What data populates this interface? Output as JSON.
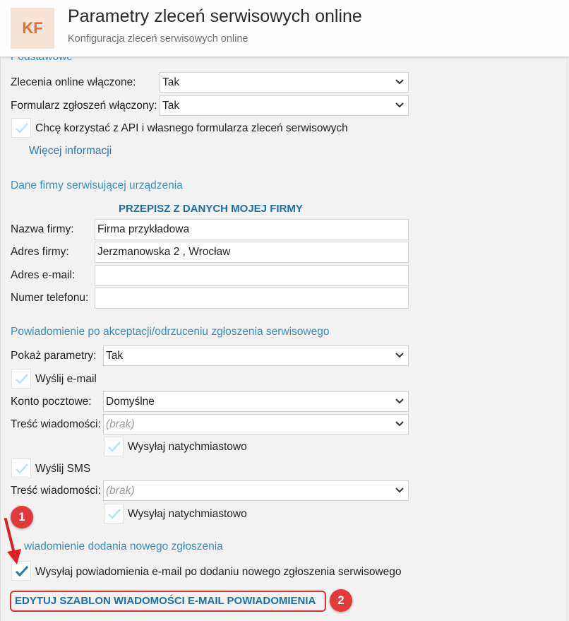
{
  "header": {
    "logo": "KF",
    "title": "Parametry zleceń serwisowych online",
    "subtitle": "Konfiguracja zleceń serwisowych online"
  },
  "basic": {
    "section_title": "Podstawowe",
    "online_orders_label": "Zlecenia online włączone:",
    "online_orders_value": "Tak",
    "form_enabled_label": "Formularz zgłoszeń włączony:",
    "form_enabled_value": "Tak",
    "api_checkbox_label": "Chcę korzystać z API i własnego formularza zleceń serwisowych",
    "api_checkbox_checked": false,
    "more_info_link": "Więcej informacji"
  },
  "company": {
    "section_title": "Dane firmy serwisującej urządzenia",
    "copy_button": "PRZEPISZ Z DANYCH MOJEJ FIRMY",
    "name_label": "Nazwa firmy:",
    "name_value": "Firma przykładowa",
    "address_label": "Adres firmy:",
    "address_value": "Jerzmanowska 2 ,  Wrocław",
    "email_label": "Adres e-mail:",
    "email_value": "",
    "phone_label": "Numer telefonu:",
    "phone_value": ""
  },
  "acceptance": {
    "section_title": "Powiadomienie po akceptacji/odrzuceniu zgłoszenia serwisowego",
    "show_params_label": "Pokaż parametry:",
    "show_params_value": "Tak",
    "send_email_label": "Wyślij e-mail",
    "send_email_checked": false,
    "mail_account_label": "Konto pocztowe:",
    "mail_account_value": "Domyślne",
    "email_content_label": "Treść wiadomości:",
    "email_content_value": "(brak)",
    "email_send_now_label": "Wysyłaj natychmiastowo",
    "email_send_now_checked": false,
    "send_sms_label": "Wyślij SMS",
    "send_sms_checked": false,
    "sms_content_label": "Treść wiadomości:",
    "sms_content_value": "(brak)",
    "sms_send_now_label": "Wysyłaj natychmiastowo",
    "sms_send_now_checked": false
  },
  "new_order": {
    "section_title": "wiadomienie dodania nowego zgłoszenia",
    "notify_label": "Wysyłaj powiadomienia e-mail po dodaniu nowego zgłoszenia serwisowego",
    "notify_checked": true,
    "edit_template_button": "EDYTUJ SZABLON WIADOMOŚCI E-MAIL POWIADOMIENIA"
  },
  "annotations": {
    "badge_1": "1",
    "badge_2": "2",
    "color": "#e03a3a"
  },
  "colors": {
    "accent": "#3a8fc0",
    "link": "#2a7ab8",
    "check_active": "#1a7ac8",
    "check_inactive": "#bfe0f2"
  }
}
